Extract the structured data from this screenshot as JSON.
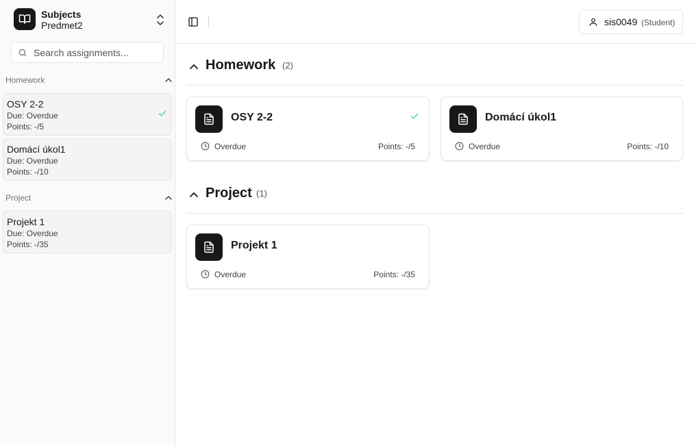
{
  "sidebar": {
    "subject_title": "Subjects",
    "subject_name": "Predmet2",
    "search_placeholder": "Search assignments...",
    "groups": [
      {
        "label": "Homework",
        "items": [
          {
            "name": "OSY 2-2",
            "due": "Due: Overdue",
            "points": "Points: -/5",
            "completed": true
          },
          {
            "name": "Domácí úkol1",
            "due": "Due: Overdue",
            "points": "Points: -/10",
            "completed": false
          }
        ]
      },
      {
        "label": "Project",
        "items": [
          {
            "name": "Projekt 1",
            "due": "Due: Overdue",
            "points": "Points: -/35",
            "completed": false
          }
        ]
      }
    ]
  },
  "topbar": {
    "user_name": "sis0049",
    "user_role": "(Student)"
  },
  "sections": [
    {
      "title": "Homework",
      "count": "(2)",
      "cards": [
        {
          "title": "OSY 2-2",
          "status": "Overdue",
          "points": "Points: -/5",
          "completed": true
        },
        {
          "title": "Domácí úkol1",
          "status": "Overdue",
          "points": "Points: -/10",
          "completed": false
        }
      ]
    },
    {
      "title": "Project",
      "count": "(1)",
      "cards": [
        {
          "title": "Projekt 1",
          "status": "Overdue",
          "points": "Points: -/35",
          "completed": false
        }
      ]
    }
  ],
  "colors": {
    "accent_dark": "#18181b",
    "check_green": "#4ade80",
    "border": "#e4e4e7",
    "sidebar_bg": "#fafafa"
  },
  "icons": {
    "subject_logo": "book-open-icon",
    "switcher": "chevrons-up-down-icon",
    "search": "search-icon",
    "group_toggle": "chevron-up-icon",
    "completed": "check-icon",
    "sidebar_toggle": "panel-left-icon",
    "user": "user-icon",
    "card": "file-text-icon",
    "due": "clock-icon"
  }
}
